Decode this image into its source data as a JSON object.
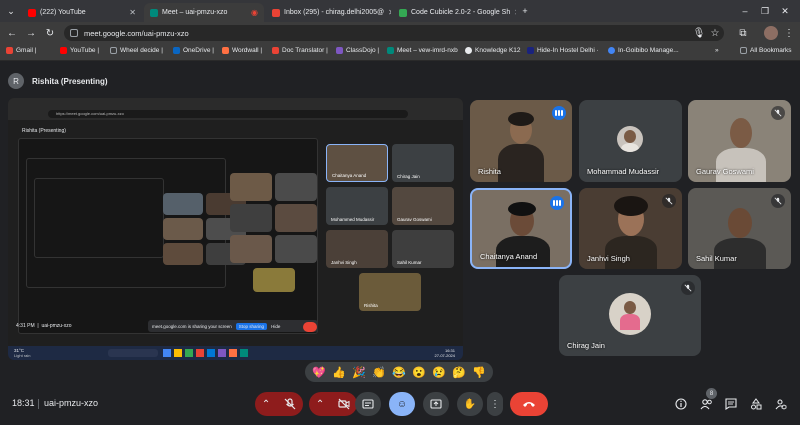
{
  "browser": {
    "tabs": [
      {
        "title": "(222) YouTube",
        "color": "#ff0000"
      },
      {
        "title": "Meet – uai-pmzu-xzo",
        "color": "#00897b"
      },
      {
        "title": "Inbox (295) - chirag.delhi2005@",
        "color": "#ea4335"
      },
      {
        "title": "Code Cubicle 2.0-2 - Google Sh",
        "color": "#34a853"
      }
    ],
    "url": "meet.google.com/uai-pmzu-xzo",
    "bookmarks": [
      {
        "label": "Gmail |",
        "color": "#ea4335"
      },
      {
        "label": "YouTube |",
        "color": "#ff0000"
      },
      {
        "label": "Wheel decide |",
        "color": "#9aa0a6"
      },
      {
        "label": "OneDrive |",
        "color": "#0a66c2"
      },
      {
        "label": "Wordwall |",
        "color": "#ff7043"
      },
      {
        "label": "Doc Translator |",
        "color": "#ea4335"
      },
      {
        "label": "ClassDojo |",
        "color": "#7e57c2"
      },
      {
        "label": "Meet – vew-imrd-nxb",
        "color": "#00897b"
      },
      {
        "label": "Knowledge K12",
        "color": "#e8eaed"
      },
      {
        "label": "Hide-In Hostel Delhi ·",
        "color": "#1a237e"
      },
      {
        "label": "In-Goibibo Manage...",
        "color": "#4285f4"
      }
    ],
    "all_bookmarks": "All Bookmarks",
    "more_bookmarks": "»"
  },
  "meet": {
    "presenter_initial": "R",
    "presenter_title": "Rishita (Presenting)",
    "participants": [
      {
        "name": "Rishita",
        "speaking": true
      },
      {
        "name": "Mohammad Mudassir",
        "speaking": false
      },
      {
        "name": "Gaurav Goswami",
        "speaking": false
      },
      {
        "name": "Chaitanya Anand",
        "speaking": true
      },
      {
        "name": "Janhvi Singh",
        "speaking": false
      },
      {
        "name": "Sahil Kumar",
        "speaking": false
      },
      {
        "name": "Chirag Jain",
        "speaking": false
      }
    ],
    "reactions": [
      "💖",
      "👍",
      "🎉",
      "👏",
      "😂",
      "😮",
      "😢",
      "🤔",
      "👎"
    ],
    "clock": "18:31",
    "meeting_code": "uai-pmzu-xzo",
    "people_count": "8"
  },
  "shared_screen": {
    "url": "https://meet.google.com/uai-pmzu-xzo",
    "title": "Rishita (Presenting)",
    "footer_code": "uai-pmzu-xzo",
    "footer_time": "4:31 PM",
    "tiles": [
      "Chaitanya Anand",
      "Chirag Jain",
      "Mohammed Mudassir",
      "Gaurav Goswami",
      "Janhvi Singh",
      "Sahil Kumar",
      "Rishita"
    ],
    "stop_sharing": "Stop sharing",
    "share_msg": "meet.google.com is sharing your screen",
    "hide": "Hide",
    "taskbar_weather": "31°C",
    "taskbar_weather_sub": "Light rain",
    "taskbar_date": "27-07-2024",
    "taskbar_time": "16:31"
  }
}
